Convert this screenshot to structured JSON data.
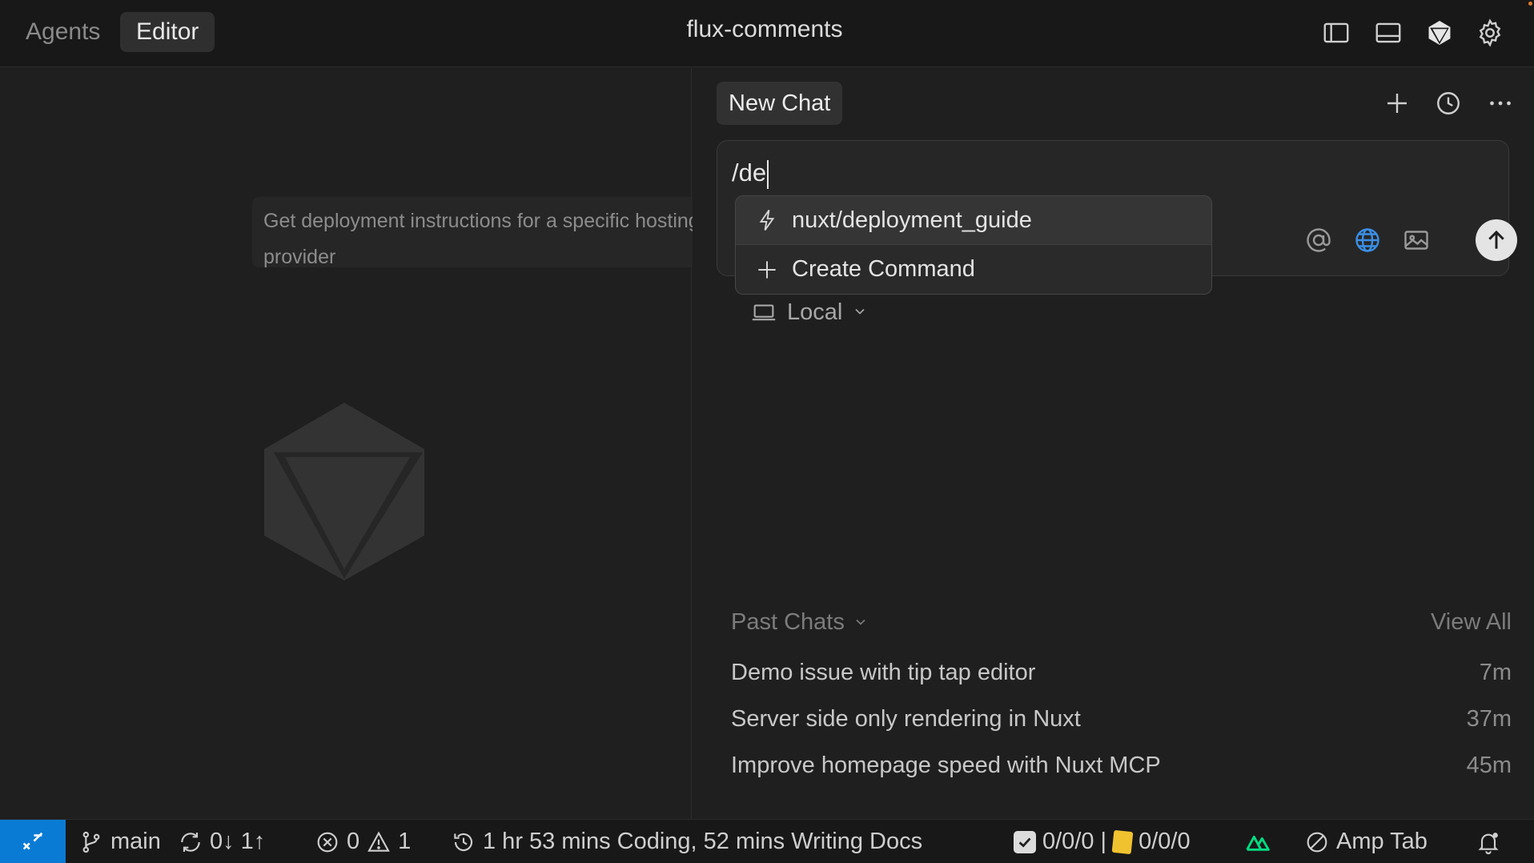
{
  "titlebar": {
    "tabs": [
      "Agents",
      "Editor"
    ],
    "active_tab": "Editor",
    "title": "flux-comments",
    "icons": [
      "toggle-sidebar-icon",
      "toggle-panel-icon",
      "cube-icon",
      "settings-icon"
    ]
  },
  "editor": {
    "watermark_icon": "cursor-cube-logo",
    "tooltip": "Get deployment instructions for a specific hosting provider"
  },
  "chat": {
    "tab_label": "New Chat",
    "actions": [
      "plus-icon",
      "history-icon",
      "more-icon"
    ],
    "composer": {
      "value": "/de",
      "buttons": [
        "at-mention-icon",
        "globe-icon",
        "image-icon",
        "send-arrow-icon"
      ],
      "accent_color": "#3b8fe6"
    },
    "mode": {
      "label": "Local",
      "icon": "laptop-icon"
    },
    "command_menu": {
      "items": [
        {
          "label": "nuxt/deployment_guide",
          "icon": "lightning-icon"
        },
        {
          "label": "Create Command",
          "icon": "plus-icon"
        }
      ]
    },
    "past_chats": {
      "title": "Past Chats",
      "view_all": "View All",
      "items": [
        {
          "title": "Demo issue with tip tap editor",
          "time": "7m"
        },
        {
          "title": "Server side only rendering in Nuxt",
          "time": "37m"
        },
        {
          "title": "Improve homepage speed with Nuxt MCP",
          "time": "45m"
        }
      ]
    }
  },
  "statusbar": {
    "remote_color": "#0a7bd4",
    "branch": "main",
    "sync": "0↓ 1↑",
    "errors": "0",
    "warnings": "1",
    "coding_time": "1 hr 53 mins Coding, 52 mins Writing Docs",
    "tasks": "0/0/0 |",
    "notes": "0/0/0",
    "nuxt_color": "#00dc82",
    "amp_tab": "Amp Tab"
  }
}
